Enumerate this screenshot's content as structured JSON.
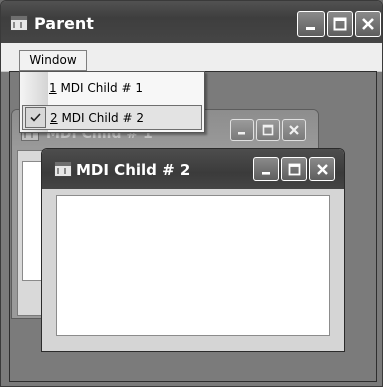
{
  "parent": {
    "title": "Parent",
    "icon": "form-icon",
    "controls": [
      "minimize-icon",
      "maximize-icon",
      "close-icon"
    ]
  },
  "menubar": {
    "window_label": "Window"
  },
  "window_menu": {
    "items": [
      {
        "mnemonic": "1",
        "text": " MDI Child # 1",
        "checked": false
      },
      {
        "mnemonic": "2",
        "text": " MDI Child # 2",
        "checked": true
      }
    ]
  },
  "child1": {
    "title": "MDI Child # 1",
    "active": false
  },
  "child2": {
    "title": "MDI Child # 2",
    "active": true
  },
  "colors": {
    "titlebar_active": "#3e3e3e",
    "titlebar_inactive": "#8d8d8d",
    "mdi_background": "#7b7b7b",
    "menu_background": "#f7f7f7"
  }
}
